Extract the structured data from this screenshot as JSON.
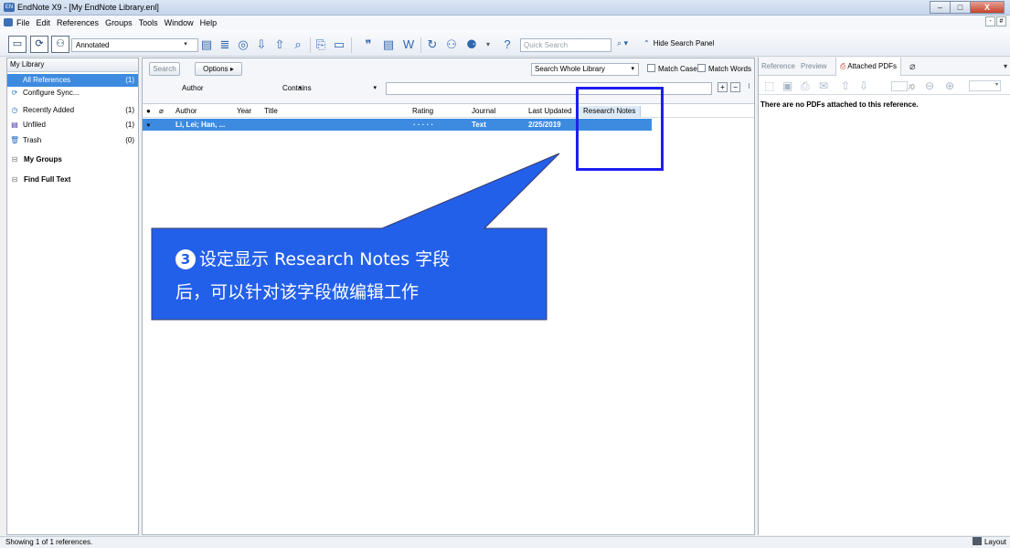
{
  "window": {
    "title": "EndNote X9 - [My EndNote Library.enl]",
    "min": "–",
    "max": "□",
    "close": "X"
  },
  "menu": [
    "File",
    "Edit",
    "References",
    "Groups",
    "Tools",
    "Window",
    "Help"
  ],
  "mdi": [
    "-",
    "#"
  ],
  "toolbar": {
    "style_value": "Annotated",
    "quick_search_placeholder": "Quick Search",
    "hide_search_panel": "Hide Search Panel"
  },
  "sidebar": {
    "header": "My Library",
    "all_refs": {
      "label": "All References",
      "count": "(1)"
    },
    "configure_sync": "Configure Sync...",
    "recently_added": {
      "label": "Recently Added",
      "count": "(1)"
    },
    "unfiled": {
      "label": "Unfiled",
      "count": "(1)"
    },
    "trash": {
      "label": "Trash",
      "count": "(0)"
    },
    "my_groups": "My Groups",
    "find_full_text": "Find Full Text"
  },
  "search": {
    "search_btn": "Search",
    "options_btn": "Options ▸",
    "scope": "Search Whole Library",
    "match_case": "Match Case",
    "match_words": "Match Words",
    "field": "Author",
    "operator": "Contains"
  },
  "columns": {
    "author": "Author",
    "year": "Year",
    "title": "Title",
    "rating": "Rating",
    "journal": "Journal",
    "last_updated": "Last Updated",
    "research_notes": "Research Notes"
  },
  "reference": {
    "author": "Li, Lei; Han, ...",
    "rating": "· · · · ·",
    "journal": "Text",
    "last_updated": "2/25/2019"
  },
  "right_pane": {
    "tabs": [
      "Reference",
      "Preview",
      "Attached PDFs"
    ],
    "page_of": "/0",
    "no_pdf_message": "There are no PDFs attached to this reference."
  },
  "status": {
    "text": "Showing 1 of 1 references.",
    "layout": "Layout"
  },
  "annotation": {
    "step": "3",
    "line1": "设定显示 Research Notes 字段",
    "line2": "后，可以针对该字段做编辑工作"
  },
  "colors": {
    "selection": "#3d8be0",
    "callout": "#2360ea",
    "highlight": "#1d1ef0"
  }
}
